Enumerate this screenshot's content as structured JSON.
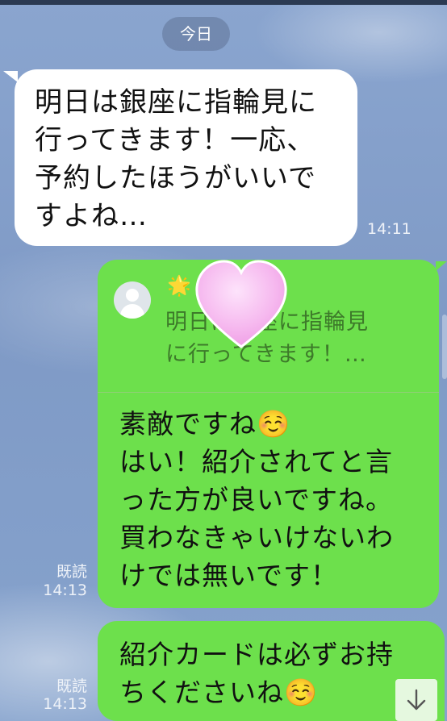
{
  "chat": {
    "date_separator": "今日",
    "messages": [
      {
        "side": "incoming",
        "text": "明日は銀座に指輪見に\n行ってきます！一応、\n予約したほうがいいで\nすよね…",
        "time": "14:11"
      },
      {
        "side": "outgoing",
        "reply_to": {
          "sender_icon": "star-icon",
          "name_glyph": "🌟",
          "text": "明日は銀座に指輪見\nに行ってきます！…"
        },
        "text": "素敵ですね☺️\nはい！紹介されてと言\nった方が良いですね。\n買わなきゃいけないわ\nけでは無いです！",
        "read": "既読",
        "time": "14:13"
      },
      {
        "side": "outgoing",
        "text": "紹介カードは必ずお持\nちくださいね☺️",
        "read": "既読",
        "time": "14:13"
      }
    ]
  },
  "overlay": {
    "sticker": "heart-sticker"
  },
  "controls": {
    "scroll_down": "arrow-down-icon"
  },
  "colors": {
    "outgoing_bubble": "#6de04c",
    "incoming_bubble": "#ffffff",
    "background": "#7f9cc8"
  }
}
